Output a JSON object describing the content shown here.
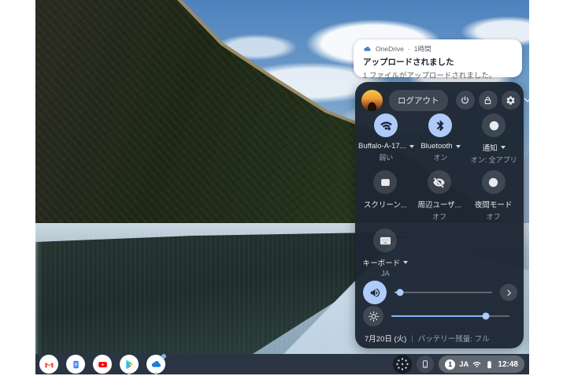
{
  "notification": {
    "app_name": "OneDrive",
    "separator": "·",
    "time_ago": "1時間",
    "title": "アップロードされました",
    "body": "1 ファイルがアップロードされました。"
  },
  "quick_settings": {
    "logout_label": "ログアウト",
    "tiles": [
      {
        "id": "network",
        "label": "Buffalo-A-17...",
        "sublabel": "弱い",
        "state": "active"
      },
      {
        "id": "bluetooth",
        "label": "Bluetooth",
        "sublabel": "オン",
        "state": "active"
      },
      {
        "id": "notifications",
        "label": "通知",
        "sublabel": "オン: 全アプリ",
        "state": "inactive"
      },
      {
        "id": "screen-capture",
        "label": "スクリーン...",
        "sublabel": "",
        "state": "inactive"
      },
      {
        "id": "nearby-visibility",
        "label": "周辺ユーザ...",
        "sublabel": "オフ",
        "state": "inactive"
      },
      {
        "id": "night-mode",
        "label": "夜間モード",
        "sublabel": "オフ",
        "state": "inactive"
      },
      {
        "id": "keyboard",
        "label": "キーボード",
        "sublabel": "JA",
        "state": "inactive"
      }
    ],
    "volume_percent": 6,
    "brightness_percent": 80,
    "footer": {
      "date": "7月20日 (火)",
      "divider": "|",
      "battery": "バッテリー残量: フル"
    }
  },
  "shelf": {
    "app_icons": [
      "gmail",
      "google-docs",
      "youtube",
      "google-play",
      "onedrive"
    ],
    "status_tray": {
      "notification_count": "1",
      "ime_label": "JA",
      "time": "12:48"
    }
  },
  "colors": {
    "accent_blue": "#8ab4f8",
    "tile_active": "#aecbfa",
    "panel_bg": "#1e2734",
    "shelf_bg": "#2b3442",
    "onedrive_blue": "#4f82c2"
  }
}
